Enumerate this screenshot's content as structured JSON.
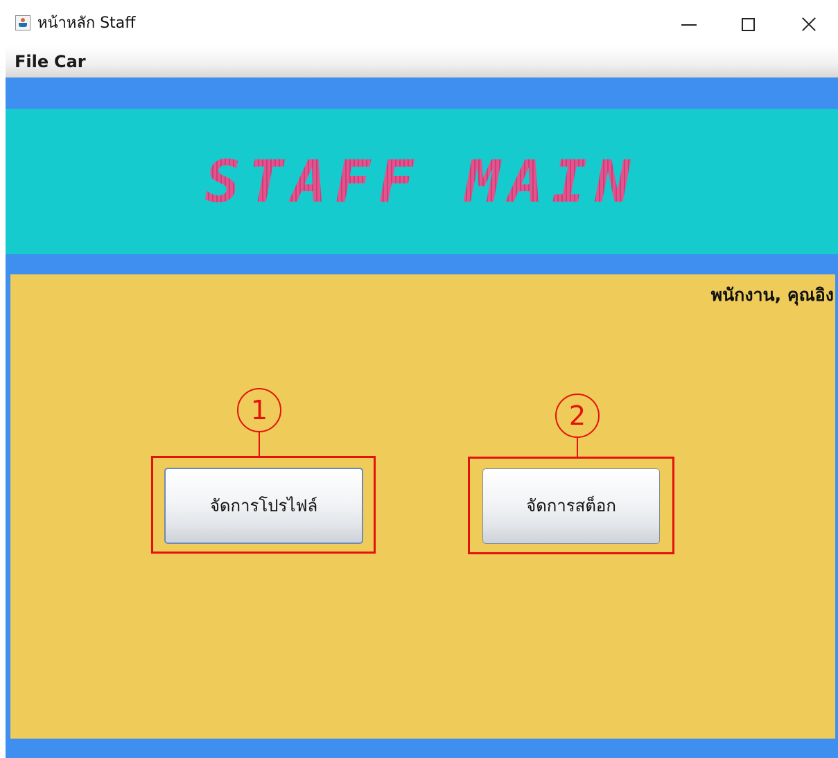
{
  "window": {
    "title": "หน้าหลัก Staff",
    "controls": [
      "minimize",
      "maximize",
      "close"
    ]
  },
  "menubar": {
    "items": [
      {
        "label": "File"
      },
      {
        "label": "Car"
      }
    ]
  },
  "banner": {
    "title": "STAFF MAIN"
  },
  "panel": {
    "user_label": "พนักงาน, คุณอิง",
    "buttons": [
      {
        "label": "จัดการโปรไฟล์",
        "annotation": "1"
      },
      {
        "label": "จัดการสต็อก",
        "annotation": "2"
      }
    ]
  },
  "colors": {
    "accent_blue": "#3f8ff0",
    "banner_cyan": "#16cbcd",
    "banner_title_pink": "#e5538e",
    "panel_yellow": "#efcb5a",
    "annotation_red": "#e3120b"
  }
}
